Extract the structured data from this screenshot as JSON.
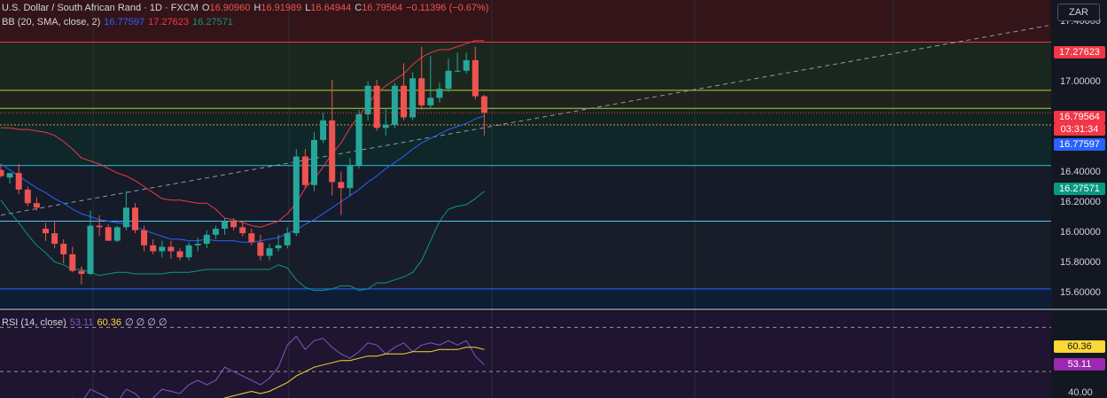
{
  "header": {
    "symbol": "U.S. Dollar / South African Rand · 1D · FXCM",
    "open_label": "O",
    "open": "16.90960",
    "high_label": "H",
    "high": "16.91989",
    "low_label": "L",
    "low": "16.64944",
    "close_label": "C",
    "close": "16.79564",
    "change": "−0.11396 (−0.67%)",
    "bb_label": "BB (20, SMA, close, 2)",
    "bb_basis": "16.77597",
    "bb_upper": "17.27623",
    "bb_lower": "16.27571"
  },
  "rsi_header": {
    "label": "RSI (14, close)",
    "rsi_value": "53.11",
    "ma_value": "60.36",
    "placeholders": "∅ ∅ ∅ ∅"
  },
  "currency": "ZAR",
  "price_labels": {
    "upper": "17.27623",
    "last": "16.79564",
    "countdown": "03:31:34",
    "basis": "16.77597",
    "lower": "16.27571",
    "rsi_ma": "60.36",
    "rsi": "53.11"
  },
  "colors": {
    "bg": "#131722",
    "up": "#26a69a",
    "down": "#ef5350",
    "upper_band": "#f23645",
    "basis": "#2962ff",
    "lower_band": "#089981",
    "rsi_line": "#7e57c2",
    "rsi_ma": "#fdd835",
    "last_price": "#f23645"
  },
  "chart_data": {
    "type": "candlestick",
    "y_ticks": [
      "17.40000",
      "17.20000",
      "17.00000",
      "16.40000",
      "16.20000",
      "16.00000",
      "15.80000",
      "15.60000"
    ],
    "ylim": [
      15.5,
      17.55
    ],
    "candles": [
      {
        "o": 16.42,
        "h": 16.46,
        "l": 16.37,
        "c": 16.38
      },
      {
        "o": 16.37,
        "h": 16.4,
        "l": 16.33,
        "c": 16.4
      },
      {
        "o": 16.4,
        "h": 16.46,
        "l": 16.26,
        "c": 16.29
      },
      {
        "o": 16.29,
        "h": 16.31,
        "l": 16.18,
        "c": 16.2
      },
      {
        "o": 16.2,
        "h": 16.24,
        "l": 16.15,
        "c": 16.17
      },
      {
        "o": 16.03,
        "h": 16.07,
        "l": 15.95,
        "c": 16.0
      },
      {
        "o": 16.0,
        "h": 16.08,
        "l": 15.9,
        "c": 15.93
      },
      {
        "o": 15.93,
        "h": 15.96,
        "l": 15.8,
        "c": 15.86
      },
      {
        "o": 15.86,
        "h": 15.91,
        "l": 15.74,
        "c": 15.75
      },
      {
        "o": 15.75,
        "h": 15.78,
        "l": 15.66,
        "c": 15.73
      },
      {
        "o": 15.73,
        "h": 16.15,
        "l": 15.72,
        "c": 16.05
      },
      {
        "o": 16.05,
        "h": 16.12,
        "l": 15.98,
        "c": 16.04
      },
      {
        "o": 16.04,
        "h": 16.06,
        "l": 15.95,
        "c": 15.95
      },
      {
        "o": 15.95,
        "h": 16.05,
        "l": 15.94,
        "c": 16.04
      },
      {
        "o": 16.04,
        "h": 16.28,
        "l": 16.02,
        "c": 16.17
      },
      {
        "o": 16.17,
        "h": 16.2,
        "l": 16.0,
        "c": 16.02
      },
      {
        "o": 16.02,
        "h": 16.05,
        "l": 15.88,
        "c": 15.92
      },
      {
        "o": 15.92,
        "h": 15.96,
        "l": 15.86,
        "c": 15.88
      },
      {
        "o": 15.88,
        "h": 15.95,
        "l": 15.84,
        "c": 15.91
      },
      {
        "o": 15.91,
        "h": 15.95,
        "l": 15.83,
        "c": 15.88
      },
      {
        "o": 15.88,
        "h": 15.9,
        "l": 15.82,
        "c": 15.84
      },
      {
        "o": 15.84,
        "h": 15.94,
        "l": 15.82,
        "c": 15.92
      },
      {
        "o": 15.92,
        "h": 15.97,
        "l": 15.88,
        "c": 15.93
      },
      {
        "o": 15.93,
        "h": 16.02,
        "l": 15.9,
        "c": 15.99
      },
      {
        "o": 15.99,
        "h": 16.05,
        "l": 15.96,
        "c": 16.03
      },
      {
        "o": 16.03,
        "h": 16.1,
        "l": 15.99,
        "c": 16.08
      },
      {
        "o": 16.08,
        "h": 16.1,
        "l": 16.02,
        "c": 16.04
      },
      {
        "o": 16.04,
        "h": 16.08,
        "l": 15.98,
        "c": 16.0
      },
      {
        "o": 16.0,
        "h": 16.03,
        "l": 15.92,
        "c": 15.94
      },
      {
        "o": 15.94,
        "h": 15.99,
        "l": 15.82,
        "c": 15.85
      },
      {
        "o": 15.85,
        "h": 15.93,
        "l": 15.82,
        "c": 15.9
      },
      {
        "o": 15.9,
        "h": 15.99,
        "l": 15.88,
        "c": 15.92
      },
      {
        "o": 15.92,
        "h": 16.04,
        "l": 15.9,
        "c": 16.0
      },
      {
        "o": 16.0,
        "h": 16.56,
        "l": 15.98,
        "c": 16.51
      },
      {
        "o": 16.51,
        "h": 16.56,
        "l": 16.3,
        "c": 16.32
      },
      {
        "o": 16.32,
        "h": 16.67,
        "l": 16.28,
        "c": 16.62
      },
      {
        "o": 16.62,
        "h": 16.8,
        "l": 16.6,
        "c": 16.75
      },
      {
        "o": 16.75,
        "h": 17.02,
        "l": 16.25,
        "c": 16.34
      },
      {
        "o": 16.34,
        "h": 16.41,
        "l": 16.12,
        "c": 16.3
      },
      {
        "o": 16.3,
        "h": 16.5,
        "l": 16.25,
        "c": 16.45
      },
      {
        "o": 16.45,
        "h": 16.82,
        "l": 16.43,
        "c": 16.79
      },
      {
        "o": 16.79,
        "h": 17.01,
        "l": 16.75,
        "c": 16.98
      },
      {
        "o": 16.98,
        "h": 17.02,
        "l": 16.68,
        "c": 16.7
      },
      {
        "o": 16.7,
        "h": 16.83,
        "l": 16.65,
        "c": 16.72
      },
      {
        "o": 16.72,
        "h": 17.0,
        "l": 16.7,
        "c": 16.98
      },
      {
        "o": 16.98,
        "h": 17.13,
        "l": 16.75,
        "c": 16.77
      },
      {
        "o": 16.77,
        "h": 17.07,
        "l": 16.75,
        "c": 17.03
      },
      {
        "o": 17.03,
        "h": 17.24,
        "l": 16.82,
        "c": 16.85
      },
      {
        "o": 16.85,
        "h": 17.18,
        "l": 16.83,
        "c": 16.9
      },
      {
        "o": 16.9,
        "h": 17.0,
        "l": 16.87,
        "c": 16.96
      },
      {
        "o": 16.96,
        "h": 17.16,
        "l": 16.94,
        "c": 17.08
      },
      {
        "o": 17.08,
        "h": 17.2,
        "l": 17.07,
        "c": 17.08
      },
      {
        "o": 17.08,
        "h": 17.2,
        "l": 17.06,
        "c": 17.15
      },
      {
        "o": 17.15,
        "h": 17.24,
        "l": 16.89,
        "c": 16.91
      },
      {
        "o": 16.91,
        "h": 16.92,
        "l": 16.65,
        "c": 16.8
      }
    ],
    "bb_upper": [
      16.7,
      16.7,
      16.69,
      16.69,
      16.68,
      16.67,
      16.65,
      16.61,
      16.56,
      16.5,
      16.48,
      16.46,
      16.43,
      16.4,
      16.38,
      16.35,
      16.31,
      16.27,
      16.23,
      16.22,
      16.22,
      16.21,
      16.2,
      16.2,
      16.16,
      16.1,
      16.09,
      16.07,
      16.05,
      16.04,
      16.06,
      16.08,
      16.13,
      16.2,
      16.3,
      16.36,
      16.44,
      16.53,
      16.6,
      16.7,
      16.78,
      16.86,
      16.93,
      16.98,
      17.02,
      17.06,
      17.12,
      17.17,
      17.2,
      17.22,
      17.22,
      17.24,
      17.26,
      17.28,
      17.28
    ],
    "bb_basis": [
      16.46,
      16.42,
      16.38,
      16.34,
      16.3,
      16.27,
      16.23,
      16.2,
      16.16,
      16.13,
      16.11,
      16.09,
      16.08,
      16.07,
      16.06,
      16.04,
      16.02,
      16.0,
      15.98,
      15.96,
      15.96,
      15.95,
      15.95,
      15.96,
      15.95,
      15.95,
      15.95,
      15.94,
      15.94,
      15.95,
      15.96,
      15.97,
      16.0,
      16.02,
      16.06,
      16.09,
      16.13,
      16.17,
      16.21,
      16.25,
      16.29,
      16.34,
      16.38,
      16.43,
      16.47,
      16.51,
      16.56,
      16.6,
      16.63,
      16.66,
      16.69,
      16.71,
      16.73,
      16.76,
      16.78
    ],
    "bb_lower": [
      16.22,
      16.14,
      16.07,
      15.99,
      15.92,
      15.87,
      15.81,
      15.79,
      15.76,
      15.76,
      15.74,
      15.72,
      15.73,
      15.74,
      15.74,
      15.73,
      15.73,
      15.73,
      15.73,
      15.74,
      15.74,
      15.74,
      15.75,
      15.76,
      15.76,
      15.76,
      15.76,
      15.76,
      15.76,
      15.76,
      15.76,
      15.79,
      15.77,
      15.69,
      15.64,
      15.62,
      15.62,
      15.63,
      15.65,
      15.65,
      15.62,
      15.63,
      15.67,
      15.67,
      15.69,
      15.71,
      15.74,
      15.82,
      15.95,
      16.08,
      16.16,
      16.18,
      16.19,
      16.23,
      16.28
    ],
    "trendline": {
      "start": {
        "bar": 0,
        "value": 16.12
      },
      "end": {
        "bar": 117,
        "value": 17.38
      }
    },
    "horizontal_levels": [
      17.27,
      16.95,
      16.83,
      16.72,
      16.45,
      16.08,
      15.63
    ],
    "rsi": [
      30,
      30,
      30,
      30,
      30,
      30,
      30,
      34,
      38,
      36,
      42,
      40,
      38,
      36,
      42,
      40,
      36,
      38,
      42,
      41,
      40,
      44,
      46,
      44,
      46,
      52,
      50,
      48,
      46,
      44,
      47,
      52,
      62,
      66,
      60,
      64,
      65,
      61,
      58,
      56,
      59,
      63,
      62,
      58,
      61,
      63,
      59,
      62,
      63,
      62,
      64,
      62,
      64,
      57,
      53
    ],
    "rsi_ma": [
      30,
      30,
      30,
      30,
      30,
      30,
      30,
      30,
      30,
      30,
      30,
      30,
      30,
      30,
      30,
      30,
      30,
      30,
      30,
      30,
      31,
      33,
      34,
      35,
      36,
      38,
      39,
      40,
      41,
      40,
      41,
      43,
      45,
      48,
      50,
      52,
      53,
      54,
      55,
      55,
      56,
      57,
      57,
      58,
      58,
      58,
      59,
      59,
      59,
      60,
      60,
      60,
      61,
      61,
      60
    ],
    "rsi_levels": [
      70,
      50,
      30
    ],
    "rsi_ylim": [
      38,
      77
    ],
    "rsi_ticks": [
      "40.00"
    ]
  }
}
